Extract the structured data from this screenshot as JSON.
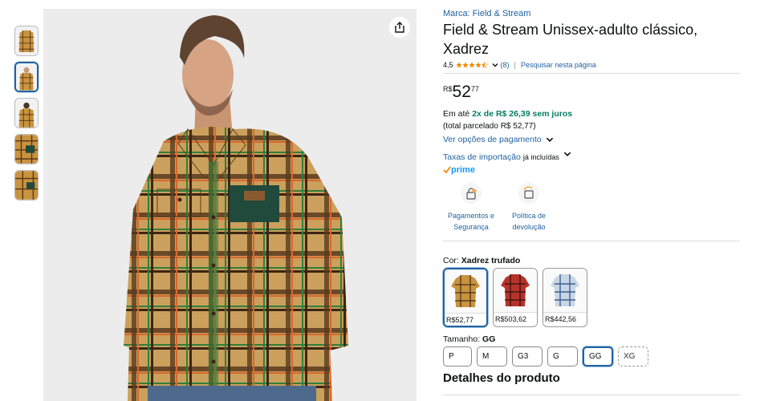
{
  "product": {
    "brand": "Marca: Field & Stream",
    "title": "Field & Stream Unissex-adulto clássico, Xadrez",
    "rating": "4,5",
    "review_count": "(8)",
    "search_page_link": "Pesquisar nesta página"
  },
  "price": {
    "currency": "R$",
    "whole": "52",
    "fraction": "77"
  },
  "installments": {
    "prefix": "Em até",
    "offer": "2x de R$ 26,39 sem juros",
    "total": "(total parcelado R$ 52,77)",
    "payment_options_link": "Ver opções de pagamento"
  },
  "import": {
    "link": "Taxas de importação",
    "note": "já incluídas"
  },
  "prime": {
    "label": "prime"
  },
  "features": [
    {
      "label": "Pagamentos e Segurança",
      "icon": "lock-card-icon"
    },
    {
      "label": "Política de devolução",
      "icon": "return-box-icon"
    }
  ],
  "color": {
    "label": "Cor:",
    "selected": "Xadrez trufado",
    "options": [
      {
        "price": "R$52,77",
        "swatch": "#c9933f"
      },
      {
        "price": "R$503,62",
        "swatch": "#b8322b"
      },
      {
        "price": "R$442,56",
        "swatch": "#7c9ec4"
      }
    ]
  },
  "size": {
    "label": "Tamanho:",
    "selected": "GG",
    "options": [
      "P",
      "M",
      "G3",
      "G",
      "GG",
      "XG"
    ]
  },
  "details_heading": "Detalhes do produto",
  "colors": {
    "link": "#2162a1",
    "green": "#067d62",
    "star": "#f08804",
    "prime": "#1399ff"
  }
}
